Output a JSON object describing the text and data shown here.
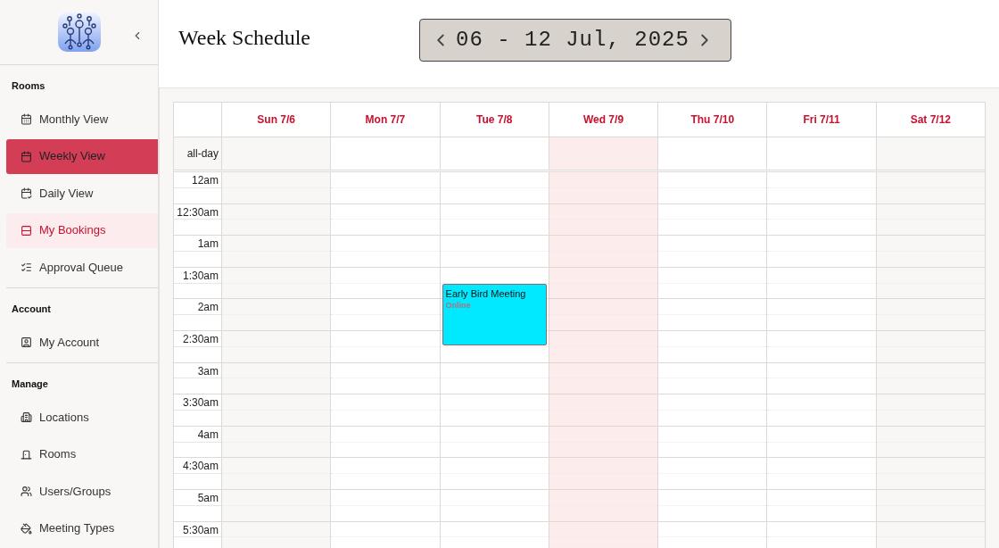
{
  "sidebar": {
    "sections": [
      {
        "title": "Rooms",
        "items": [
          {
            "label": "Monthly View",
            "selected": false,
            "highlighted": false
          },
          {
            "label": "Weekly View",
            "selected": true,
            "highlighted": false
          },
          {
            "label": "Daily View",
            "selected": false,
            "highlighted": false
          },
          {
            "label": "My Bookings",
            "selected": false,
            "highlighted": true
          },
          {
            "label": "Approval Queue",
            "selected": false,
            "highlighted": false
          }
        ]
      },
      {
        "title": "Account",
        "items": [
          {
            "label": "My Account",
            "selected": false,
            "highlighted": false
          }
        ]
      },
      {
        "title": "Manage",
        "items": [
          {
            "label": "Locations",
            "selected": false,
            "highlighted": false
          },
          {
            "label": "Rooms",
            "selected": false,
            "highlighted": false
          },
          {
            "label": "Users/Groups",
            "selected": false,
            "highlighted": false
          },
          {
            "label": "Meeting Types",
            "selected": false,
            "highlighted": false
          }
        ]
      }
    ]
  },
  "header": {
    "title": "Week Schedule",
    "date_range": "06 - 12 Jul, 2025"
  },
  "calendar": {
    "all_day_label": "all-day",
    "days": [
      {
        "label": "Sun 7/6",
        "kind": "weekend"
      },
      {
        "label": "Mon 7/7",
        "kind": "weekday"
      },
      {
        "label": "Tue 7/8",
        "kind": "weekday",
        "events": [
          {
            "title": "Early Bird Meeting",
            "location": "Online",
            "color": "#00e9ff"
          }
        ]
      },
      {
        "label": "Wed 7/9",
        "kind": "today"
      },
      {
        "label": "Thu 7/10",
        "kind": "weekday"
      },
      {
        "label": "Fri 7/11",
        "kind": "weekday"
      },
      {
        "label": "Sat 7/12",
        "kind": "weekend"
      }
    ],
    "times": [
      "12am",
      "12:30am",
      "1am",
      "1:30am",
      "2am",
      "2:30am",
      "3am",
      "3:30am",
      "4am",
      "4:30am",
      "5am",
      "5:30am"
    ]
  }
}
